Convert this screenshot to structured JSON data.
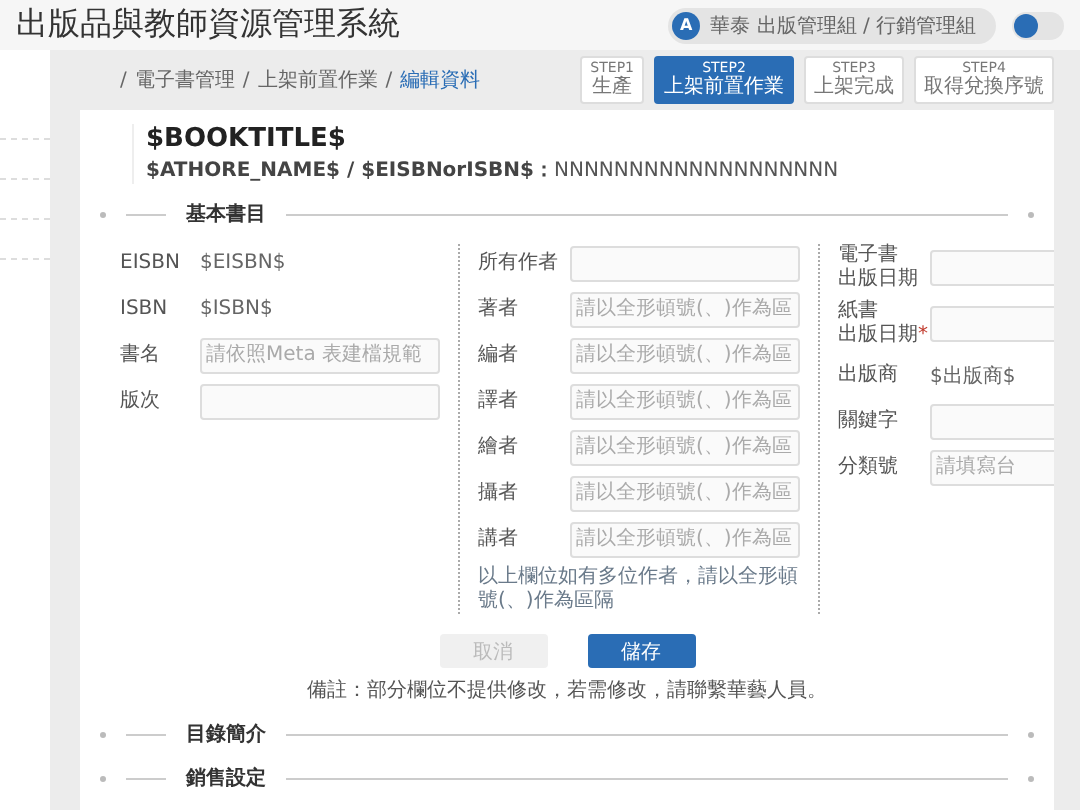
{
  "header": {
    "title": "出版品與教師資源管理系統",
    "user": {
      "avatar": "A",
      "name": "華泰 出版管理組 / 行銷管理組"
    },
    "toggle": {
      "on": false
    }
  },
  "breadcrumb": [
    {
      "separator": "/",
      "label": "電子書管理",
      "selected": false
    },
    {
      "separator": "/",
      "label": "上架前置作業",
      "selected": false
    },
    {
      "separator": "/",
      "label": "編輯資料",
      "selected": true
    }
  ],
  "steps": [
    {
      "step": "STEP1",
      "label": "生產",
      "selected": false
    },
    {
      "step": "STEP2",
      "label": "上架前置作業",
      "selected": true
    },
    {
      "step": "STEP3",
      "label": "上架完成",
      "selected": false
    },
    {
      "step": "STEP4",
      "label": "取得兌換序號",
      "selected": false
    }
  ],
  "book": {
    "title": "$BOOKTITLE$",
    "subtitle_label": "$ATHORE_NAME$ / $EISBNorISBN$：",
    "subtitle_value": "NNNNNNNNNNNNNNNNNNN"
  },
  "sections": [
    {
      "title": "基本書目"
    },
    {
      "title": "目錄簡介"
    },
    {
      "title": "銷售設定"
    }
  ],
  "form_columns": [
    {
      "fields": [
        {
          "kind": "text",
          "label": "EISBN",
          "value": "$EISBN$"
        },
        {
          "kind": "text",
          "label": "ISBN",
          "value": "$ISBN$"
        },
        {
          "kind": "input",
          "label": "書名",
          "placeholder": "請依照Meta 表建檔規範"
        },
        {
          "kind": "input",
          "label": "版次"
        }
      ]
    },
    {
      "fields": [
        {
          "kind": "input",
          "label": "所有作者"
        },
        {
          "kind": "input",
          "label": "著者",
          "placeholder": "請以全形頓號(、)作為區"
        },
        {
          "kind": "input",
          "label": "編者",
          "placeholder": "請以全形頓號(、)作為區"
        },
        {
          "kind": "input",
          "label": "譯者",
          "placeholder": "請以全形頓號(、)作為區"
        },
        {
          "kind": "input",
          "label": "繪者",
          "placeholder": "請以全形頓號(、)作為區"
        },
        {
          "kind": "input",
          "label": "攝者",
          "placeholder": "請以全形頓號(、)作為區"
        },
        {
          "kind": "input",
          "label": "講者",
          "placeholder": "請以全形頓號(、)作為區"
        }
      ],
      "help": "以上欄位如有多位作者，請以全形頓號(、)作為區隔"
    },
    {
      "fields": [
        {
          "kind": "input",
          "label_lines": [
            "電子書",
            "出版日期"
          ]
        },
        {
          "kind": "input",
          "label_lines": [
            "紙書",
            "出版日期"
          ],
          "required_mark": "*"
        },
        {
          "kind": "text",
          "label": "出版商",
          "value": "$出版商$"
        },
        {
          "kind": "input",
          "label": "關鍵字"
        },
        {
          "kind": "input",
          "label": "分類號",
          "placeholder": "請填寫台"
        }
      ]
    }
  ],
  "form_buttons": [
    {
      "label": "取消",
      "kind": "secondary",
      "disabled": true
    },
    {
      "label": "儲存",
      "kind": "primary",
      "disabled": false
    }
  ],
  "note": "備註：部分欄位不提供修改，若需修改，請聯繫華藝人員。"
}
